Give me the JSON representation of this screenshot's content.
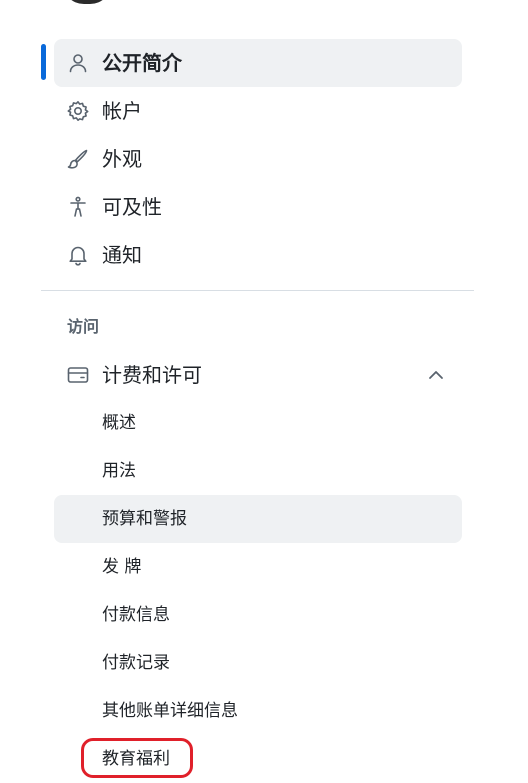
{
  "nav": {
    "items": [
      {
        "label": "公开简介",
        "icon": "person-icon",
        "active": true
      },
      {
        "label": "帐户",
        "icon": "gear-icon"
      },
      {
        "label": "外观",
        "icon": "paintbrush-icon"
      },
      {
        "label": "可及性",
        "icon": "accessibility-icon"
      },
      {
        "label": "通知",
        "icon": "bell-icon"
      }
    ]
  },
  "access": {
    "section_title": "访问",
    "billing": {
      "label": "计费和许可",
      "icon": "credit-card-icon",
      "expanded": true,
      "sub_items": [
        {
          "label": "概述"
        },
        {
          "label": "用法"
        },
        {
          "label": "预算和警报",
          "hovered": true
        },
        {
          "label": "发 牌"
        },
        {
          "label": "付款信息"
        },
        {
          "label": "付款记录"
        },
        {
          "label": "其他账单详细信息"
        },
        {
          "label": "教育福利",
          "annotated": true
        }
      ]
    }
  },
  "colors": {
    "accent": "#0969da",
    "annotation": "#e0202a",
    "active_background": "#eff1f3"
  }
}
